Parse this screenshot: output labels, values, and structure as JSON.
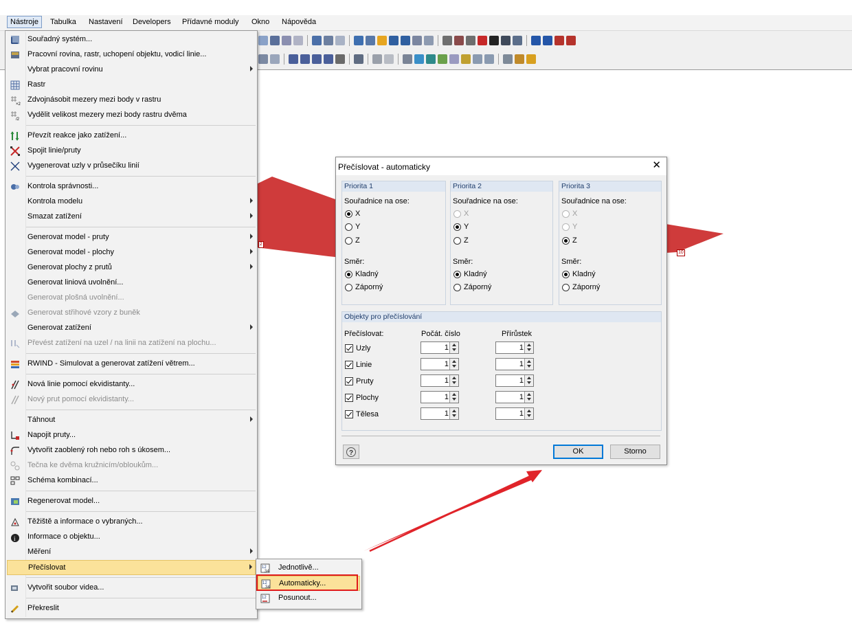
{
  "menubar": {
    "items": [
      "Nástroje",
      "Tabulka",
      "Nastavení",
      "Developers",
      "Přídavné moduly",
      "Okno",
      "Nápověda"
    ]
  },
  "canvas": {
    "node_labels": [
      "2",
      "10"
    ],
    "colors": {
      "surface": "#cf3b3b",
      "arrow": "#e0242a"
    }
  },
  "tools_menu": {
    "items": [
      {
        "label": "Souřadný systém...",
        "icon": "coordinate-system-icon"
      },
      {
        "label": "Pracovní rovina, rastr, uchopení objektu, vodicí linie...",
        "icon": "work-plane-icon"
      },
      {
        "label": "Vybrat pracovní rovinu",
        "submenu": true
      },
      {
        "label": "Rastr",
        "icon": "grid-icon"
      },
      {
        "label": "Zdvojnásobit mezery mezi body v rastru",
        "icon": "grid-double-icon"
      },
      {
        "label": "Vydělit velikost mezery mezi body rastru dvěma",
        "icon": "grid-half-icon"
      },
      {
        "label": "Převzít reakce jako zatížení...",
        "icon": "reactions-icon"
      },
      {
        "label": "Spojit linie/pruty",
        "icon": "connect-lines-icon"
      },
      {
        "label": "Vygenerovat uzly v průsečíku linií",
        "icon": "intersection-icon"
      },
      {
        "label": "Kontrola správnosti...",
        "icon": "check-icon"
      },
      {
        "label": "Kontrola modelu",
        "submenu": true
      },
      {
        "label": "Smazat zatížení",
        "submenu": true
      },
      {
        "label": "Generovat model - pruty",
        "submenu": true
      },
      {
        "label": "Generovat model - plochy",
        "submenu": true
      },
      {
        "label": "Generovat plochy z prutů",
        "submenu": true
      },
      {
        "label": "Generovat liniová uvolnění..."
      },
      {
        "label": "Generovat plošná uvolnění...",
        "disabled": true
      },
      {
        "label": "Generovat střihové vzory z buněk",
        "disabled": true,
        "icon": "cutting-pattern-icon"
      },
      {
        "label": "Generovat zatížení",
        "submenu": true
      },
      {
        "label": "Převést zatížení na uzel / na linii na zatížení na plochu...",
        "disabled": true,
        "icon": "convert-load-icon"
      },
      {
        "label": "RWIND - Simulovat a generovat zatížení větrem...",
        "icon": "rwind-icon"
      },
      {
        "label": "Nová linie pomocí ekvidistanty...",
        "icon": "equidistant-line-icon"
      },
      {
        "label": "Nový prut pomocí ekvidistanty...",
        "disabled": true,
        "icon": "equidistant-member-icon"
      },
      {
        "label": "Táhnout",
        "submenu": true
      },
      {
        "label": "Napojit pruty...",
        "icon": "join-members-icon"
      },
      {
        "label": "Vytvořit zaoblený roh nebo roh s úkosem...",
        "icon": "fillet-icon"
      },
      {
        "label": "Tečna ke dvěma kružnicím/obloukům...",
        "disabled": true,
        "icon": "tangent-icon"
      },
      {
        "label": "Schéma kombinací...",
        "icon": "combination-scheme-icon"
      },
      {
        "label": "Regenerovat model...",
        "icon": "regenerate-icon"
      },
      {
        "label": "Těžiště a informace o vybraných...",
        "icon": "centroid-icon"
      },
      {
        "label": "Informace o objektu...",
        "icon": "info-icon"
      },
      {
        "label": "Měření",
        "submenu": true
      },
      {
        "label": "Přečíslovat",
        "submenu": true,
        "highlighted": true
      },
      {
        "label": "Vytvořit soubor videa...",
        "icon": "video-icon"
      },
      {
        "label": "Překreslit",
        "icon": "redraw-icon"
      }
    ]
  },
  "submenu": {
    "items": [
      {
        "label": "Jednotlivě...",
        "icon": "renumber-single-icon"
      },
      {
        "label": "Automaticky...",
        "icon": "renumber-auto-icon",
        "highlighted": true
      },
      {
        "label": "Posunout...",
        "icon": "renumber-shift-icon"
      }
    ]
  },
  "dialog": {
    "title": "Přečíslovat - automaticky",
    "priorities": [
      {
        "header": "Priorita 1",
        "axis_label": "Souřadnice na ose:",
        "axes": [
          "X",
          "Y",
          "Z"
        ],
        "selected_axis": "X",
        "direction_label": "Směr:",
        "directions": [
          "Kladný",
          "Záporný"
        ],
        "selected_direction": "Kladný"
      },
      {
        "header": "Priorita 2",
        "axis_label": "Souřadnice na ose:",
        "axes": [
          "X",
          "Y",
          "Z"
        ],
        "selected_axis": "Y",
        "direction_label": "Směr:",
        "directions": [
          "Kladný",
          "Záporný"
        ],
        "selected_direction": "Kladný"
      },
      {
        "header": "Priorita 3",
        "axis_label": "Souřadnice na ose:",
        "axes": [
          "X",
          "Y",
          "Z"
        ],
        "selected_axis": "Z",
        "direction_label": "Směr:",
        "directions": [
          "Kladný",
          "Záporný"
        ],
        "selected_direction": "Kladný"
      }
    ],
    "objects": {
      "header": "Objekty pro přečíslování",
      "col_renumber": "Přečíslovat:",
      "col_start": "Počát. číslo",
      "col_increment": "Přírůstek",
      "rows": [
        {
          "label": "Uzly",
          "checked": true,
          "start": "1",
          "increment": "1"
        },
        {
          "label": "Linie",
          "checked": true,
          "start": "1",
          "increment": "1"
        },
        {
          "label": "Pruty",
          "checked": true,
          "start": "1",
          "increment": "1"
        },
        {
          "label": "Plochy",
          "checked": true,
          "start": "1",
          "increment": "1"
        },
        {
          "label": "Tělesa",
          "checked": true,
          "start": "1",
          "increment": "1"
        }
      ]
    },
    "ok_label": "OK",
    "cancel_label": "Storno"
  }
}
